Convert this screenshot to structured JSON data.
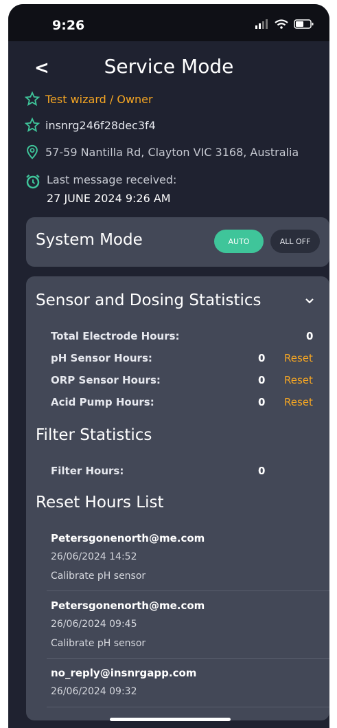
{
  "status": {
    "time": "9:26"
  },
  "header": {
    "title": "Service Mode",
    "back_glyph": "<"
  },
  "info": {
    "owner": "Test wizard / Owner",
    "device_id": "insnrg246f28dec3f4",
    "address": "57-59 Nantilla Rd, Clayton VIC 3168, Australia",
    "last_message_label": "Last message received:",
    "last_message_value": "27 JUNE 2024 9:26 AM"
  },
  "system_mode": {
    "label": "System Mode",
    "auto_label": "AUTO",
    "off_label": "ALL OFF",
    "selected": "AUTO"
  },
  "sensor_stats": {
    "title": "Sensor and Dosing Statistics",
    "rows": [
      {
        "label": "Total Electrode Hours:",
        "value": "0"
      },
      {
        "label": "pH Sensor Hours:",
        "value": "0",
        "action": "Reset"
      },
      {
        "label": "ORP Sensor Hours:",
        "value": "0",
        "action": "Reset"
      },
      {
        "label": "Acid Pump Hours:",
        "value": "0",
        "action": "Reset"
      }
    ]
  },
  "filter_stats": {
    "title": "Filter Statistics",
    "label": "Filter Hours:",
    "value": "0"
  },
  "reset_list": {
    "title": "Reset Hours List",
    "entries": [
      {
        "email": "Petersgonenorth@me.com",
        "datetime": "26/06/2024 14:52",
        "action": "Calibrate pH sensor"
      },
      {
        "email": "Petersgonenorth@me.com",
        "datetime": "26/06/2024 09:45",
        "action": "Calibrate pH sensor"
      },
      {
        "email": "no_reply@insnrgapp.com",
        "datetime": "26/06/2024 09:32"
      }
    ]
  },
  "colors": {
    "accent_orange": "#f5a623",
    "auto_green": "#3fc59a",
    "icon_green": "#3fc59a",
    "background": "#1f2230",
    "card": "#434857"
  }
}
